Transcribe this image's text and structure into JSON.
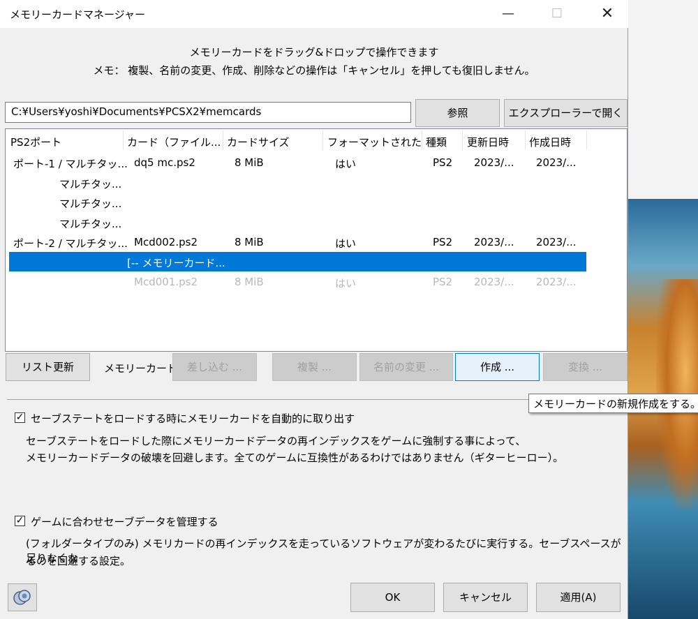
{
  "window": {
    "title": "メモリーカードマネージャー",
    "min": "—",
    "max": "☐",
    "close": "✕"
  },
  "hints": [
    "メモリーカードをドラッグ&ドロップで操作できます",
    "メモ： 複製、名前の変更、作成、削除などの操作は「キャンセル」を押しても復旧しません。"
  ],
  "path": {
    "value": "C:¥Users¥yoshi¥Documents¥PCSX2¥memcards"
  },
  "buttons": {
    "browse": "参照",
    "explorer": "エクスプローラーで開く",
    "refresh": "リスト更新",
    "insert": "差し込む ...",
    "duplicate": "複製 ...",
    "rename": "名前の変更 ...",
    "create": "作成 ...",
    "convert": "変換 ...",
    "ok": "OK",
    "cancel": "キャンセル",
    "apply": "適用(A)"
  },
  "table": {
    "headers": [
      "PS2ポート",
      "カード（ファイル...",
      "カードサイズ",
      "フォーマットされた",
      "種類",
      "更新日時",
      "作成日時"
    ],
    "rows": [
      {
        "port": "ポート-1 / マルチタッ...",
        "card": "dq5 mc.ps2",
        "size": "8 MiB",
        "formatted": "はい",
        "type": "PS2",
        "modified": "2023/...",
        "created": "2023/..."
      },
      {
        "port": "マルチタッ...",
        "card": "",
        "size": "",
        "formatted": "",
        "type": "",
        "modified": "",
        "created": ""
      },
      {
        "port": "マルチタッ...",
        "card": "",
        "size": "",
        "formatted": "",
        "type": "",
        "modified": "",
        "created": ""
      },
      {
        "port": "マルチタッ...",
        "card": "",
        "size": "",
        "formatted": "",
        "type": "",
        "modified": "",
        "created": ""
      },
      {
        "port": "ポート-2 / マルチタッ...",
        "card": "Mcd002.ps2",
        "size": "8 MiB",
        "formatted": "はい",
        "type": "PS2",
        "modified": "2023/...",
        "created": "2023/..."
      },
      {
        "port": "",
        "card": "[-- メモリーカード...",
        "size": "",
        "formatted": "",
        "type": "",
        "modified": "",
        "created": ""
      },
      {
        "port": "",
        "card": "Mcd001.ps2",
        "size": "8 MiB",
        "formatted": "はい",
        "type": "PS2",
        "modified": "2023/...",
        "created": "2023/..."
      }
    ]
  },
  "memcard_label": "メモリーカード:",
  "tooltip": "メモリーカードの新規作成をする。",
  "options": {
    "autoeject": {
      "label": "セーブステートをロードする時にメモリーカードを自動的に取り出す",
      "desc1": "セーブステートをロードした際にメモリーカードデータの再インデックスをゲームに強制する事によって、",
      "desc2": "メモリーカードデータの破壊を回避します。全てのゲームに互換性があるわけではありません（ギターヒーロー）。"
    },
    "manage": {
      "label": "ゲームに合わせセーブデータを管理する",
      "desc1": "(フォルダータイプのみ) メモリカードの再インデックスを走っているソフトウェアが変わるたびに実行する。セーブスペースが足りなくな",
      "desc2": "るのを回避する設定。"
    },
    "checkmark": "✓"
  }
}
